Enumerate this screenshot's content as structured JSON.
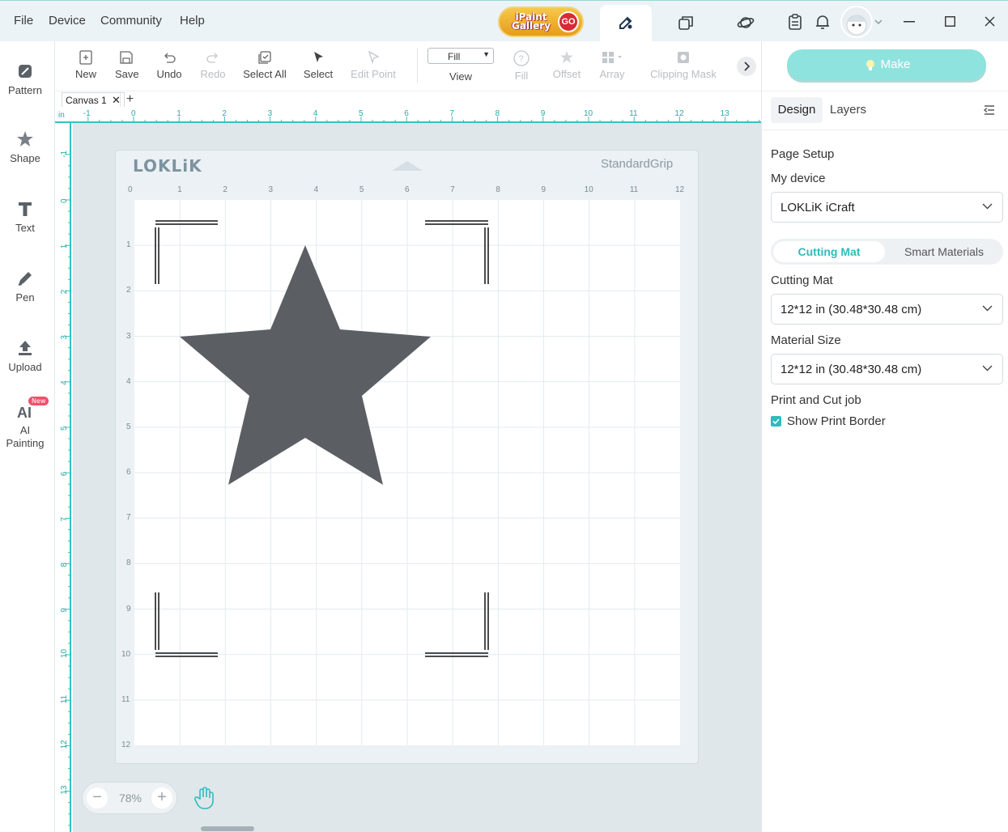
{
  "menu": {
    "file": "File",
    "device": "Device",
    "community": "Community",
    "help": "Help"
  },
  "gallery": {
    "label": "iPaint Gallery",
    "go": "GO"
  },
  "sidebar": {
    "items": [
      {
        "label": "Pattern",
        "icon": "pattern-icon"
      },
      {
        "label": "Shape",
        "icon": "shape-icon"
      },
      {
        "label": "Text",
        "icon": "text-icon"
      },
      {
        "label": "Pen",
        "icon": "pen-icon"
      },
      {
        "label": "Upload",
        "icon": "upload-icon"
      },
      {
        "label": "AI Painting",
        "icon": "ai-painting-icon",
        "badge": "New"
      }
    ]
  },
  "toolbar": {
    "new": "New",
    "save": "Save",
    "undo": "Undo",
    "redo": "Redo",
    "select_all": "Select All",
    "select": "Select",
    "edit_point": "Edit Point",
    "fill_value": "Fill",
    "view": "View",
    "fill": "Fill",
    "offset": "Offset",
    "array": "Array",
    "clipping_mask": "Clipping Mask"
  },
  "canvas_tabs": {
    "tab1": "Canvas 1",
    "add": "+"
  },
  "ruler": {
    "unit": "in"
  },
  "mat": {
    "brand": "LOKLiK",
    "type": "StandardGrip",
    "x_numbers": [
      "0",
      "1",
      "2",
      "3",
      "4",
      "5",
      "6",
      "7",
      "8",
      "9",
      "10",
      "11",
      "12"
    ],
    "y_numbers": [
      "1",
      "2",
      "3",
      "4",
      "5",
      "6",
      "7",
      "8",
      "9",
      "10",
      "11",
      "12"
    ]
  },
  "zoom": {
    "level": "78%",
    "minus": "−",
    "plus": "+"
  },
  "right_panel": {
    "make": "Make",
    "tab_design": "Design",
    "tab_layers": "Layers",
    "page_setup": "Page Setup",
    "my_device_label": "My device",
    "my_device_value": "LOKLiK iCraft",
    "seg_cutting": "Cutting Mat",
    "seg_smart": "Smart Materials",
    "cutting_mat_label": "Cutting Mat",
    "cutting_mat_value": "12*12 in (30.48*30.48 cm)",
    "material_size_label": "Material Size",
    "material_size_value": "12*12 in (30.48*30.48 cm)",
    "print_cut_label": "Print and Cut job",
    "show_print_border": "Show Print Border",
    "show_print_border_checked": true
  },
  "colors": {
    "accent": "#2fbcbc",
    "star": "#5b5f64",
    "make_button": "#8fe3df"
  }
}
